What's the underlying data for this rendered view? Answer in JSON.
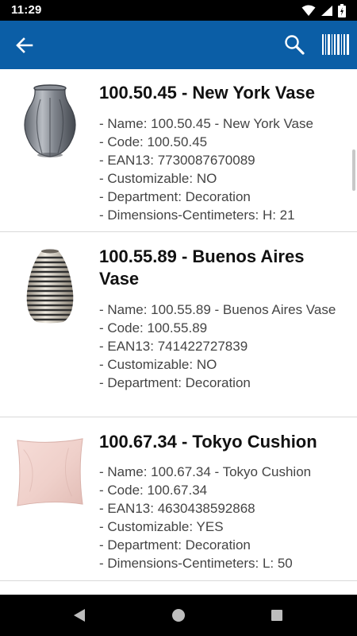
{
  "status_bar": {
    "time": "11:29",
    "icons": [
      "wifi-icon",
      "signal-icon",
      "battery-icon"
    ]
  },
  "app_bar": {
    "background_color": "#0b5ea6",
    "left_action_icon": "arrow-left-icon",
    "right_action_icons": [
      "search-icon",
      "barcode-icon"
    ]
  },
  "items": [
    {
      "title": "100.50.45 - New York Vase",
      "thumbnail": "vase-glass-image",
      "details": [
        "- Name: 100.50.45 - New York Vase",
        "- Code: 100.50.45",
        "- EAN13: 7730087670089",
        "- Customizable: NO",
        "- Department: Decoration",
        "- Dimensions-Centimeters: H: 21"
      ]
    },
    {
      "title": "100.55.89 - Buenos Aires Vase",
      "thumbnail": "vase-striped-image",
      "details": [
        "- Name: 100.55.89 - Buenos Aires Vase",
        "- Code: 100.55.89",
        "- EAN13: 741422727839",
        "- Customizable: NO",
        "- Department: Decoration"
      ]
    },
    {
      "title": "100.67.34 - Tokyo Cushion",
      "thumbnail": "cushion-pink-image",
      "details": [
        "- Name: 100.67.34 - Tokyo Cushion",
        "- Code: 100.67.34",
        "- EAN13: 4630438592868",
        "- Customizable: YES",
        "- Department: Decoration",
        "- Dimensions-Centimeters: L: 50"
      ]
    }
  ],
  "nav_bar": {
    "buttons": [
      "back-triangle-icon",
      "home-circle-icon",
      "recents-square-icon"
    ]
  }
}
